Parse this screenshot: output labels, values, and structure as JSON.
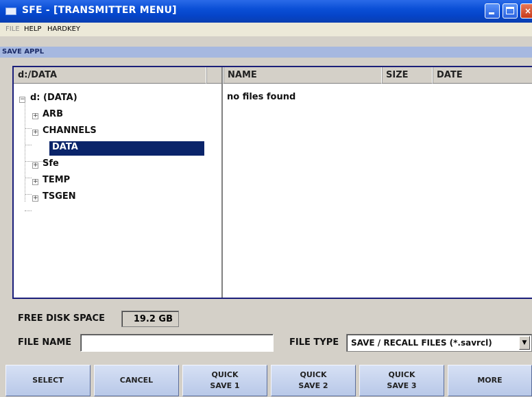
{
  "window": {
    "title": "SFE - [TRANSMITTER MENU]",
    "controls": {
      "minimize": "minimize-icon",
      "maximize": "maximize-icon",
      "close": "×"
    }
  },
  "menubar": {
    "items": [
      "FILE",
      "HELP",
      "HARDKEY"
    ]
  },
  "section": {
    "title": "SAVE APPL"
  },
  "browser": {
    "path_header": "d:/DATA",
    "tree": {
      "root": "d: (DATA)",
      "children": [
        "ARB",
        "CHANNELS",
        "DATA",
        "Sfe",
        "TEMP",
        "TSGEN"
      ],
      "selected": "DATA"
    },
    "columns": [
      "NAME",
      "SIZE",
      "DATE"
    ],
    "empty_message": "no files found"
  },
  "disk": {
    "label": "FREE DISK SPACE",
    "value": "19.2 GB"
  },
  "filename": {
    "label": "FILE NAME",
    "value": ""
  },
  "filetype": {
    "label": "FILE TYPE",
    "value": "SAVE / RECALL FILES (*.savrcl)"
  },
  "softkeys": [
    {
      "l1": "SELECT",
      "l2": ""
    },
    {
      "l1": "CANCEL",
      "l2": ""
    },
    {
      "l1": "QUICK",
      "l2": "SAVE 1"
    },
    {
      "l1": "QUICK",
      "l2": "SAVE 2"
    },
    {
      "l1": "QUICK",
      "l2": "SAVE 3"
    },
    {
      "l1": "MORE",
      "l2": ""
    }
  ],
  "colors": {
    "titlebar": "#0a4fd6",
    "selection": "#0a246a",
    "softkey": "#c4d2ee"
  }
}
